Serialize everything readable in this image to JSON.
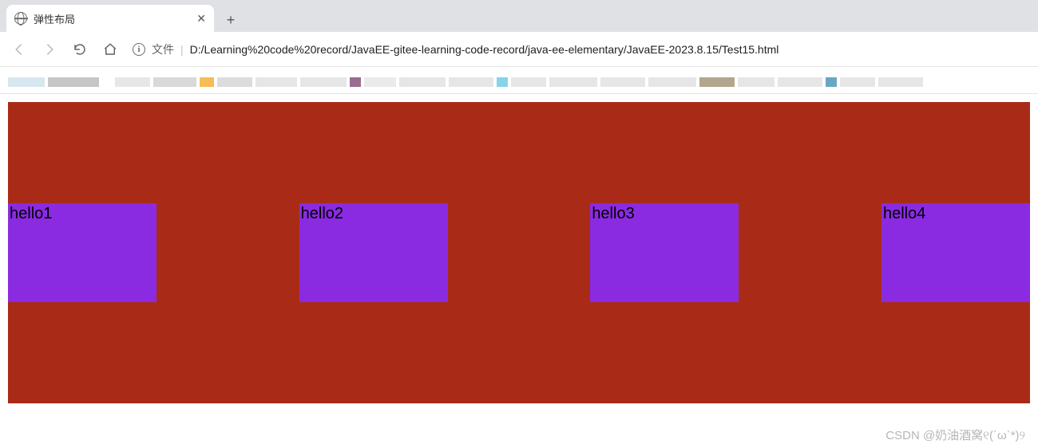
{
  "tab": {
    "title": "弹性布局",
    "close_glyph": "✕",
    "newtab_glyph": "+"
  },
  "addressbar": {
    "prefix": "文件",
    "separator": "|",
    "url": "D:/Learning%20code%20record/JavaEE-gitee-learning-code-record/java-ee-elementary/JavaEE-2023.8.15/Test15.html"
  },
  "bookmark_blocks": [
    {
      "w": 46,
      "color": "#d7e7f0"
    },
    {
      "w": 64,
      "color": "#c6c6c6"
    },
    {
      "w": 12,
      "color": "#ffffff"
    },
    {
      "w": 44,
      "color": "#e7e7e7"
    },
    {
      "w": 54,
      "color": "#d9d9d9"
    },
    {
      "w": 18,
      "color": "#f6bc56"
    },
    {
      "w": 44,
      "color": "#dcdcdc"
    },
    {
      "w": 52,
      "color": "#e6e6e6"
    },
    {
      "w": 58,
      "color": "#e6e6e6"
    },
    {
      "w": 14,
      "color": "#9a6c8f"
    },
    {
      "w": 40,
      "color": "#eaeaea"
    },
    {
      "w": 58,
      "color": "#e6e6e6"
    },
    {
      "w": 56,
      "color": "#e6e6e6"
    },
    {
      "w": 14,
      "color": "#86d3ea"
    },
    {
      "w": 44,
      "color": "#e6e6e6"
    },
    {
      "w": 60,
      "color": "#e6e6e6"
    },
    {
      "w": 56,
      "color": "#e6e6e6"
    },
    {
      "w": 60,
      "color": "#e6e6e6"
    },
    {
      "w": 44,
      "color": "#b3a68e"
    },
    {
      "w": 46,
      "color": "#e6e6e6"
    },
    {
      "w": 56,
      "color": "#e6e6e6"
    },
    {
      "w": 14,
      "color": "#6aa6c4"
    },
    {
      "w": 44,
      "color": "#e6e6e6"
    },
    {
      "w": 56,
      "color": "#e6e6e6"
    }
  ],
  "content": {
    "container_bg": "#a92b17",
    "item_bg": "#8a2be2",
    "items": [
      {
        "label": "hello1"
      },
      {
        "label": "hello2"
      },
      {
        "label": "hello3"
      },
      {
        "label": "hello4"
      }
    ]
  },
  "watermark": "CSDN @奶油酒窝୧(´ω`*)୨"
}
